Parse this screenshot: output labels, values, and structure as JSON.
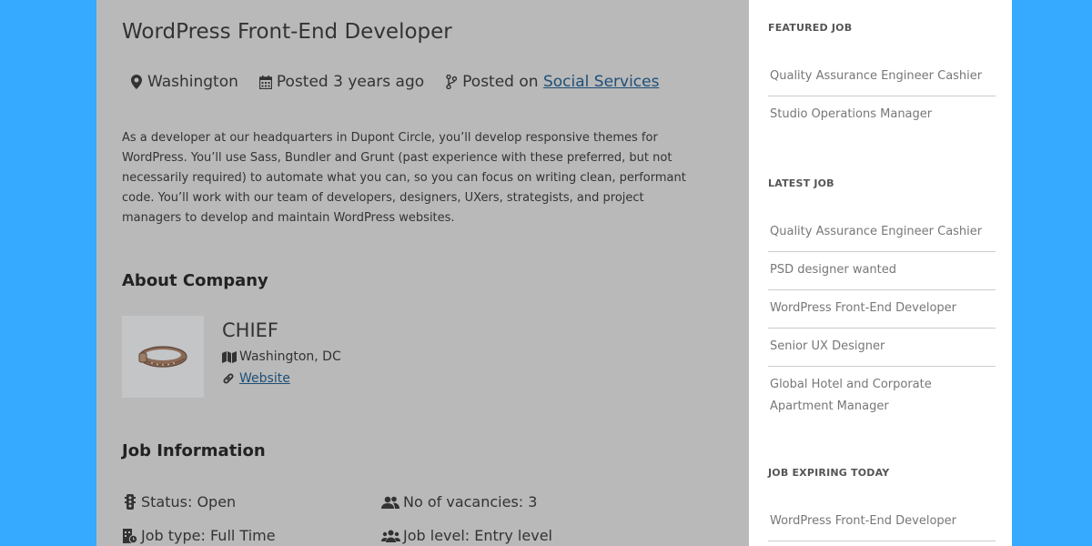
{
  "job": {
    "title": "WordPress Front-End Developer",
    "location": "Washington",
    "posted": "Posted 3 years ago",
    "posted_on_label": "Posted on",
    "category": "Social Services",
    "description": "As a developer at our headquarters in Dupont Circle, you’ll develop responsive themes for WordPress. You’ll use Sass, Bundler and Grunt (past experience with these preferred, but not necessarily required) to automate what you can, so you can focus on writing clean, performant code. You’ll work with our team of developers, designers, UXers, strategists, and project managers to develop and maintain WordPress websites."
  },
  "about": {
    "heading": "About Company",
    "company_name": "CHIEF",
    "company_location": "Washington, DC",
    "website_label": "Website"
  },
  "info": {
    "heading": "Job Information",
    "status": "Status: Open",
    "vacancies": "No of vacancies: 3",
    "job_type": "Job type: Full Time",
    "job_level": "Job level: Entry level"
  },
  "sidebar": {
    "featured": {
      "heading": "FEATURED JOB",
      "items": [
        "Quality Assurance Engineer Cashier",
        "Studio Operations Manager"
      ]
    },
    "latest": {
      "heading": "LATEST JOB",
      "items": [
        "Quality Assurance Engineer Cashier",
        "PSD designer wanted",
        "WordPress Front-End Developer",
        "Senior UX Designer",
        "Global Hotel and Corporate Apartment Manager"
      ]
    },
    "expiring": {
      "heading": "JOB EXPIRING TODAY",
      "items": [
        "WordPress Front-End Developer"
      ]
    }
  },
  "colors": {
    "background": "#35aaff",
    "main_panel": "#b9b9b9",
    "sidebar": "#ffffff",
    "link": "#1e4f78"
  }
}
